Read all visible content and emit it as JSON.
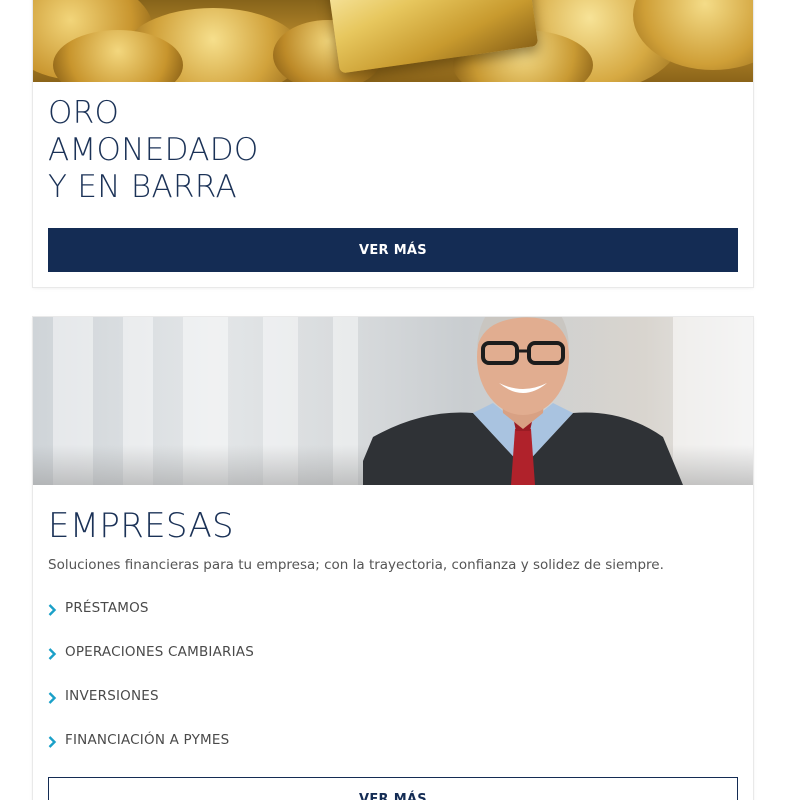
{
  "gold_card": {
    "image_alt_icon": "gold-coins-image",
    "title_lines": [
      "ORO",
      "AMONEDADO",
      "Y EN BARRA"
    ],
    "button_label": "VER MÁS"
  },
  "business_card": {
    "image_alt_icon": "businessman-photo",
    "title": "EMPRESAS",
    "description": "Soluciones financieras para tu empresa; con la trayectoria, confianza y solidez de siempre.",
    "links": [
      {
        "label": "PRÉSTAMOS"
      },
      {
        "label": "OPERACIONES CAMBIARIAS"
      },
      {
        "label": "INVERSIONES"
      },
      {
        "label": "FINANCIACIÓN A PYMES"
      }
    ],
    "button_label": "VER MÁS"
  },
  "colors": {
    "navy": "#142c54",
    "title": "#1b3257",
    "chevron": "#1aa0c8",
    "text": "#555555"
  }
}
